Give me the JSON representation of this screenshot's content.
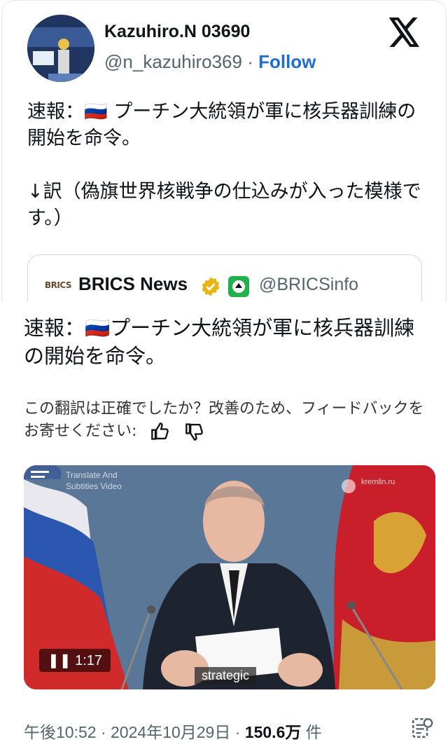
{
  "tweet": {
    "author_name": "Kazuhiro.N 03690",
    "author_handle": "@n_kazuhiro369",
    "separator": " · ",
    "follow_label": "Follow",
    "text": "速報：🇷🇺 プーチン大統領が軍に核兵器訓練の開始を命令。\n\n↓訳（偽旗世界核戦争の仕込みが入った模様です。）"
  },
  "quote": {
    "logo_text": "BRICS",
    "name": "BRICS News",
    "handle": "@BRICSinfo"
  },
  "translation": {
    "text": "速報：🇷🇺プーチン大統領が軍に核兵器訓練の開始を命令。",
    "feedback_text": "この翻訳は正確でしたか？改善のため、フィードバックをお寄せください:"
  },
  "video": {
    "duration": "1:17",
    "subtitle": "strategic",
    "watermark": "Translate And\nSubtitles Video",
    "source_watermark": "kremlin.ru"
  },
  "meta": {
    "time": "午後10:52",
    "date": "2024年10月29日",
    "views": "150.6万",
    "views_unit": " 件",
    "dot": " · "
  },
  "colors": {
    "follow": "#1d6fd1",
    "verified": "#e8b512"
  }
}
